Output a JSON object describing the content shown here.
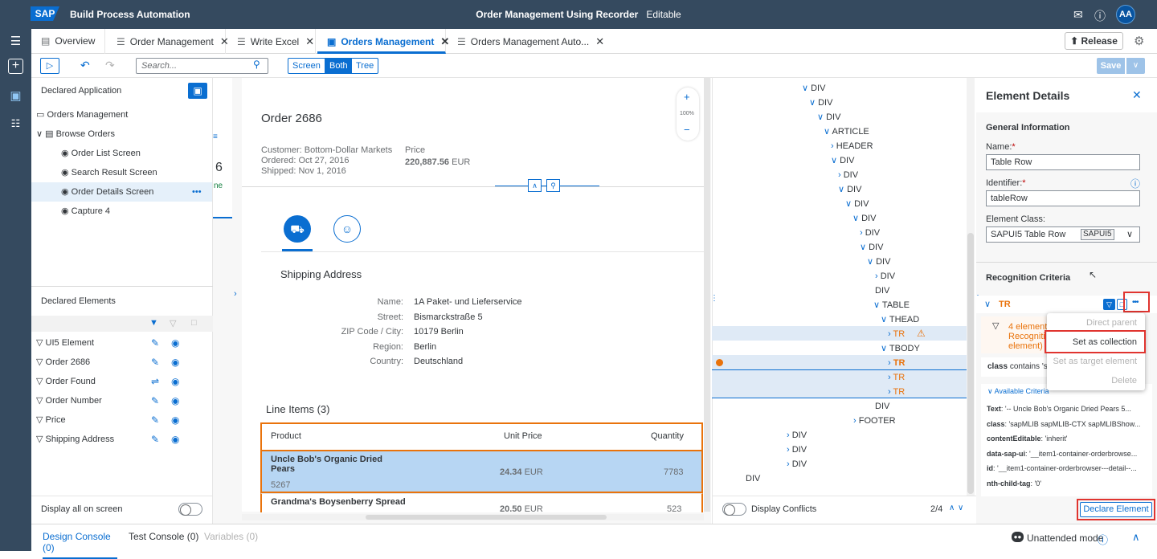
{
  "shell": {
    "logo": "SAP",
    "app_title": "Build Process Automation",
    "doc_title": "Order Management Using Recorder",
    "status": "Editable",
    "avatar": "AA"
  },
  "tabs": [
    {
      "label": "Overview",
      "icon": "document-icon"
    },
    {
      "label": "Order Management",
      "icon": "process-icon"
    },
    {
      "label": "Write Excel",
      "icon": "process-icon"
    },
    {
      "label": "Orders Management",
      "icon": "screen-icon"
    },
    {
      "label": "Orders Management Auto...",
      "icon": "process-icon"
    }
  ],
  "release_label": "Release",
  "toolbar": {
    "search_placeholder": "Search...",
    "seg_screen": "Screen",
    "seg_both": "Both",
    "seg_tree": "Tree",
    "save": "Save"
  },
  "declared_app": {
    "title": "Declared Application",
    "items": [
      "Orders Management",
      "Browse Orders",
      "Order List Screen",
      "Search Result Screen",
      "Order Details Screen",
      "Capture 4"
    ]
  },
  "declared_elements": {
    "title": "Declared Elements",
    "items": [
      "UI5 Element",
      "Order 2686",
      "Order Found",
      "Order Number",
      "Price",
      "Shipping Address"
    ],
    "display_all": "Display all on screen"
  },
  "sliver": {
    "a": "6",
    "b": "ne"
  },
  "order": {
    "title": "Order 2686",
    "customer": "Customer: Bottom-Dollar Markets",
    "ordered": "Ordered: Oct 27, 2016",
    "shipped": "Shipped: Nov 1, 2016",
    "price_label": "Price",
    "price_value": "220,887.56",
    "price_currency": "EUR",
    "zoom": "100%"
  },
  "shipping": {
    "title": "Shipping Address",
    "labels": [
      "Name:",
      "Street:",
      "ZIP Code / City:",
      "Region:",
      "Country:"
    ],
    "values": [
      "1A Paket- und Lieferservice",
      "Bismarckstraße 5",
      "10179 Berlin",
      "Berlin",
      "Deutschland"
    ]
  },
  "line_items": {
    "title": "Line Items (3)",
    "headers": [
      "Product",
      "Unit Price",
      "Quantity"
    ],
    "rows": [
      {
        "product": "Uncle Bob's Organic Dried Pears",
        "id": "5267",
        "price": "24.34",
        "cur": "EUR",
        "qty": "7783"
      },
      {
        "product": "Grandma's Boysenberry Spread",
        "id": "",
        "price": "20.50",
        "cur": "EUR",
        "qty": "523"
      }
    ]
  },
  "dom": {
    "nodes": [
      "DIV",
      "DIV",
      "DIV",
      "ARTICLE",
      "HEADER",
      "DIV",
      "DIV",
      "DIV",
      "DIV",
      "DIV",
      "DIV",
      "DIV",
      "DIV",
      "DIV",
      "DIV",
      "TABLE",
      "THEAD",
      "TR",
      "TBODY",
      "TR",
      "TR",
      "TR",
      "DIV",
      "FOOTER",
      "DIV",
      "DIV",
      "DIV",
      "DIV"
    ],
    "display_conflicts": "Display Conflicts",
    "pager": "2/4"
  },
  "details": {
    "title": "Element Details",
    "general": "General Information",
    "name_label": "Name:",
    "name_value": "Table Row",
    "id_label": "Identifier:",
    "id_value": "tableRow",
    "class_label": "Element Class:",
    "class_value": "SAPUI5 Table Row",
    "class_badge": "SAPUI5",
    "recognition": "Recognition Criteria",
    "tr": "TR",
    "warn_line1": "4 element",
    "warn_line2": "Recogniti",
    "warn_line3": "element)",
    "class_crit_key": "class",
    "class_crit_rest": "contains 's",
    "available": "Available Criteria",
    "criteria": [
      {
        "k": "Text",
        "v": ": '-- Uncle Bob's Organic Dried Pears 5..."
      },
      {
        "k": "class",
        "v": ": 'sapMLIB sapMLIB-CTX sapMLIBShow..."
      },
      {
        "k": "contentEditable",
        "v": ": 'inherit'"
      },
      {
        "k": "data-sap-ui",
        "v": ": '__item1-container-orderbrowse..."
      },
      {
        "k": "id",
        "v": ": '__item1-container-orderbrowser---detail--..."
      },
      {
        "k": "nth-child-tag",
        "v": ": '0'"
      }
    ],
    "declare": "Declare Element"
  },
  "menu": [
    "Direct parent",
    "Set as collection",
    "Set as target element",
    "Delete"
  ],
  "bottom": {
    "design": "Design Console (0)",
    "test": "Test Console (0)",
    "vars": "Variables (0)",
    "mode": "Unattended mode"
  }
}
